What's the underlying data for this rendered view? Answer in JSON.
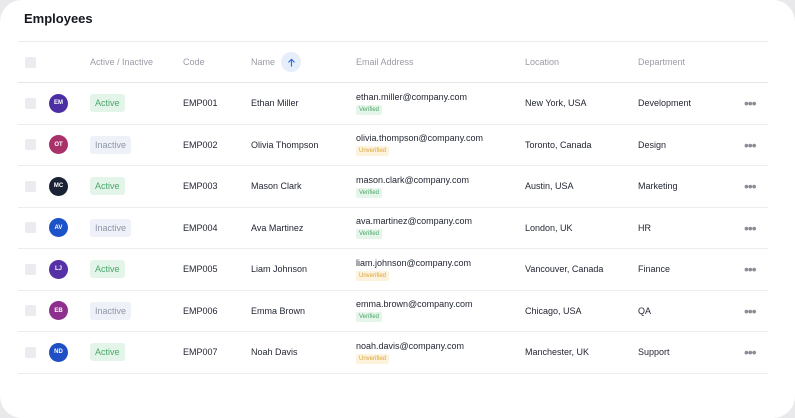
{
  "page": {
    "title": "Employees"
  },
  "columns": {
    "status": "Active / Inactive",
    "code": "Code",
    "name": "Name",
    "email": "Email Address",
    "location": "Location",
    "department": "Department"
  },
  "icons": {
    "sort": "arrow-up-icon",
    "more": "more-horizontal-icon"
  },
  "colors": {
    "active_bg": "#e3f5e9",
    "active_text": "#4aa56a",
    "inactive_bg": "#eef1f8",
    "inactive_text": "#8f95a6",
    "verified_text": "#47a565",
    "unverified_text": "#d9a53a",
    "sort_accent": "#3a6fd8"
  },
  "rows": [
    {
      "initials": "EM",
      "avatar_color": "#4b2fa3",
      "status": "Active",
      "code": "EMP001",
      "name": "Ethan Miller",
      "email": "ethan.miller@company.com",
      "verification": "Verified",
      "location": "New York, USA",
      "department": "Development"
    },
    {
      "initials": "OT",
      "avatar_color": "#a8316a",
      "status": "Inactive",
      "code": "EMP002",
      "name": "Olivia Thompson",
      "email": "olivia.thompson@company.com",
      "verification": "Unverified",
      "location": "Toronto, Canada",
      "department": "Design"
    },
    {
      "initials": "MC",
      "avatar_color": "#1c2236",
      "status": "Active",
      "code": "EMP003",
      "name": "Mason Clark",
      "email": "mason.clark@company.com",
      "verification": "Verified",
      "location": "Austin, USA",
      "department": "Marketing"
    },
    {
      "initials": "AV",
      "avatar_color": "#1d53c9",
      "status": "Inactive",
      "code": "EMP004",
      "name": "Ava Martinez",
      "email": "ava.martinez@company.com",
      "verification": "Verified",
      "location": "London, UK",
      "department": "HR"
    },
    {
      "initials": "LJ",
      "avatar_color": "#5630a6",
      "status": "Active",
      "code": "EMP005",
      "name": "Liam Johnson",
      "email": "liam.johnson@company.com",
      "verification": "Unverified",
      "location": "Vancouver, Canada",
      "department": "Finance"
    },
    {
      "initials": "EB",
      "avatar_color": "#8e2f8f",
      "status": "Inactive",
      "code": "EMP006",
      "name": "Emma Brown",
      "email": "emma.brown@company.com",
      "verification": "Verified",
      "location": "Chicago, USA",
      "department": "QA"
    },
    {
      "initials": "ND",
      "avatar_color": "#1f4fc4",
      "status": "Active",
      "code": "EMP007",
      "name": "Noah Davis",
      "email": "noah.davis@company.com",
      "verification": "Unverified",
      "location": "Manchester, UK",
      "department": "Support"
    }
  ]
}
